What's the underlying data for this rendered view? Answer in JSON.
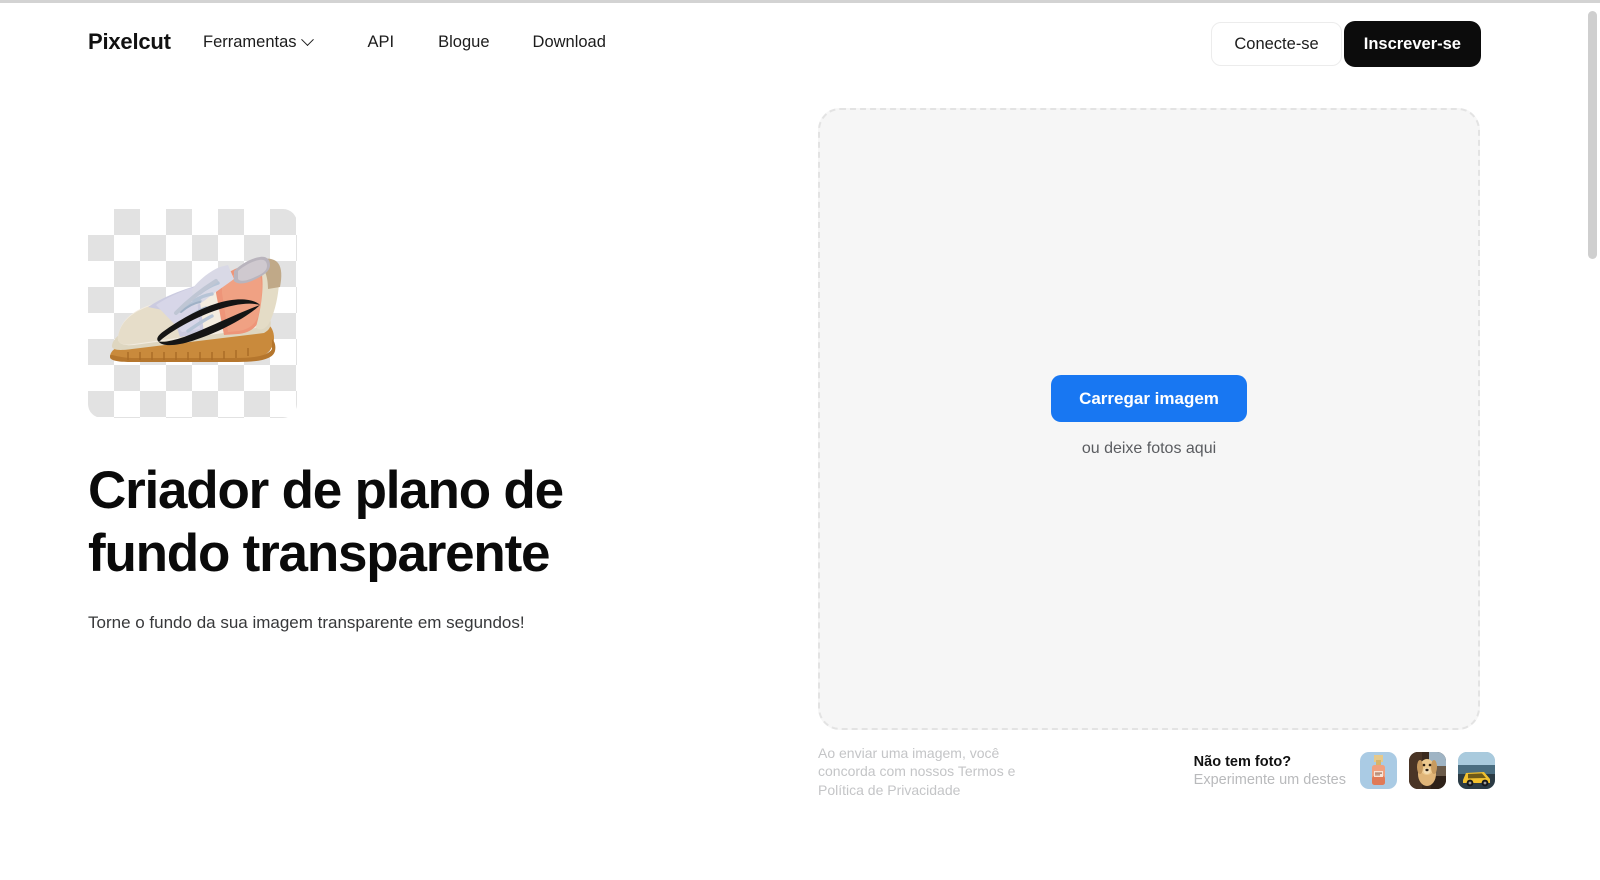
{
  "header": {
    "brand": "Pixelcut",
    "nav": [
      {
        "label": "Ferramentas",
        "icon": "chevron-down-icon",
        "has_chevron": true
      },
      {
        "label": "API",
        "has_chevron": false
      },
      {
        "label": "Blogue",
        "has_chevron": false
      },
      {
        "label": "Download",
        "has_chevron": false
      }
    ],
    "login_label": "Conecte-se",
    "signup_label": "Inscrever-se"
  },
  "hero": {
    "title": "Criador de plano de fundo transparente",
    "subtitle": "Torne o fundo da sua imagem transparente em segundos!",
    "preview_alt": "sneaker-transparent-background"
  },
  "dropzone": {
    "upload_label": "Carregar imagem",
    "hint": "ou deixe fotos aqui"
  },
  "footer": {
    "legal_line1": "Ao enviar uma imagem, você",
    "legal_line2": "concorda com nossos Termos e",
    "legal_line3": "Política de Privacidade",
    "samples_title": "Não tem foto?",
    "samples_subtitle": "Experimente um destes",
    "samples": [
      {
        "name": "sample-perfume-bottle"
      },
      {
        "name": "sample-dog"
      },
      {
        "name": "sample-yellow-car"
      }
    ]
  },
  "colors": {
    "accent_blue": "#1877f2",
    "signup_black": "#0c0c0c",
    "dropzone_bg": "#f6f6f6",
    "dropzone_border": "#e3e3e3",
    "muted_text": "#c4c5c7"
  }
}
